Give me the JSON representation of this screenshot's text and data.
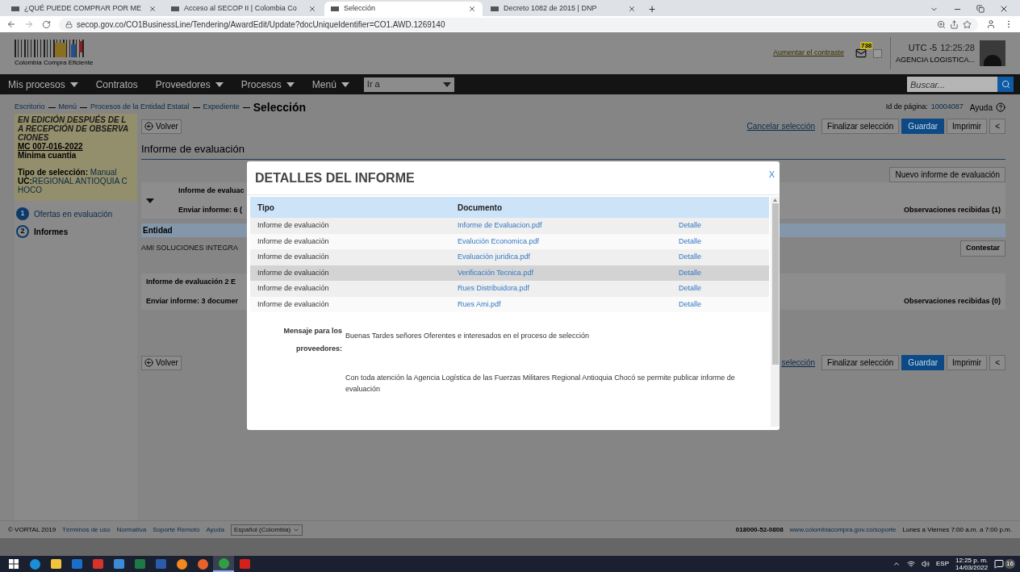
{
  "browser": {
    "tabs": [
      {
        "title": "¿QUÉ PUEDE COMPRAR POR ME",
        "selected": false
      },
      {
        "title": "Acceso al SECOP II | Colombia Co",
        "selected": false
      },
      {
        "title": "Selección",
        "selected": true
      },
      {
        "title": "Decreto 1082 de 2015 | DNP",
        "selected": false
      }
    ],
    "new_tab": "+",
    "url": "secop.gov.co/CO1BusinessLine/Tendering/AwardEdit/Update?docUniqueIdentifier=CO1.AWD.1269140"
  },
  "header": {
    "logo_text": "Colombia Compra Eficiente",
    "contrast_link": "Aumentar el contraste",
    "mail_badge": "738",
    "timezone": "UTC -5",
    "time": "12:25:28",
    "user": "AGENCIA LOGISTICA..."
  },
  "nav": {
    "items": [
      {
        "label": "Mis procesos",
        "dropdown": true
      },
      {
        "label": "Contratos",
        "dropdown": false
      },
      {
        "label": "Proveedores",
        "dropdown": true
      },
      {
        "label": "Procesos",
        "dropdown": true
      },
      {
        "label": "Menú",
        "dropdown": true
      }
    ],
    "goto": "Ir a",
    "search": {
      "placeholder": "Buscar..."
    }
  },
  "breadcrumb": {
    "items": [
      "Escritorio",
      "Menú",
      "Procesos de la Entidad Estatal",
      "Expediente"
    ],
    "current": "Selección"
  },
  "page_id": {
    "label": "Id de página:",
    "value": "10004087"
  },
  "help": "Ayuda",
  "sidebar": {
    "status": "EN EDICIÓN DESPUÉS DE LA RECEPCIÓN DE OBSERVACIONES",
    "process_number": "MC 007-016-2022",
    "modality": "Minima cuantia",
    "selection_type": {
      "label": "Tipo de selección:",
      "value": "Manual"
    },
    "uc": {
      "label": "UC:",
      "value": "REGIONAL ANTIOQUIA CHOCO"
    },
    "steps": [
      {
        "number": "1",
        "label": "Ofertas en evaluación",
        "selected": false
      },
      {
        "number": "2",
        "label": "Informes",
        "selected": true
      }
    ]
  },
  "actions": {
    "back": "Volver",
    "cancel": "Cancelar selección",
    "finish": "Finalizar selección",
    "save": "Guardar",
    "print": "Imprimir",
    "collapse": "<"
  },
  "section_title": "Informe de evaluación",
  "new_report": "Nuevo informe de evaluación",
  "reports": [
    {
      "title": "Informe de evaluac",
      "send": "Enviar informe: 6 (",
      "observations": "Observaciones recibidas (1)",
      "expanded": true
    },
    {
      "title": "Informe de evaluación 2  E",
      "send": "Enviar informe: 3 documer",
      "observations": "Observaciones recibidas (0)",
      "expanded": false
    }
  ],
  "entity_table": {
    "header": "Entidad",
    "entity": "AMI SOLUCIONES INTEGRA",
    "reply": "Contestar"
  },
  "bottom_actions": {
    "back": "Volver",
    "cancel": "selección",
    "finish": "Finalizar selección",
    "save": "Guardar",
    "print": "Imprimir",
    "collapse": "<"
  },
  "modal": {
    "title": "DETALLES DEL INFORME",
    "close": "X",
    "columns": [
      "Tipo",
      "Documento"
    ],
    "rows": [
      {
        "type": "Informe de evaluación",
        "document": "Informe de Evaluacion.pdf",
        "action": "Detalle",
        "selected": false
      },
      {
        "type": "Informe de evaluación",
        "document": "Evalución Economica.pdf",
        "action": "Detalle",
        "selected": false
      },
      {
        "type": "Informe de evaluación",
        "document": "Evaluación juridica.pdf",
        "action": "Detalle",
        "selected": false
      },
      {
        "type": "Informe de evaluación",
        "document": "Verificación Tecnica.pdf",
        "action": "Detalle",
        "selected": true
      },
      {
        "type": "Informe de evaluación",
        "document": "Rues Distribuidora.pdf",
        "action": "Detalle",
        "selected": false
      },
      {
        "type": "Informe de evaluación",
        "document": "Rues Ami.pdf",
        "action": "Detalle",
        "selected": false
      }
    ],
    "message_label": "Mensaje para los proveedores:",
    "message": [
      "Buenas Tardes señores Oferentes e interesados en el proceso de selección",
      "Con toda atención la Agencia Logística de las Fuerzas Militares Regional Antioquia Chocó se permite publicar informe de evaluación"
    ]
  },
  "footer": {
    "copyright": "© VORTAL 2019",
    "links": [
      "Términos de uso",
      "Normativa",
      "Soporte Remoto",
      "Ayuda"
    ],
    "language": "Español (Colombia)",
    "phone": "018000-52-0808",
    "support_url": "www.colombiacompra.gov.co/soporte",
    "hours": "Lunes a Viernes 7:00 a.m. a 7:00 p.m."
  },
  "taskbar": {
    "apps": [
      {
        "kind": "start",
        "selected": false
      },
      {
        "kind": "edge",
        "selected": false
      },
      {
        "kind": "files",
        "selected": false
      },
      {
        "kind": "outlook",
        "selected": false
      },
      {
        "kind": "red",
        "selected": false
      },
      {
        "kind": "tool",
        "selected": false
      },
      {
        "kind": "excel",
        "selected": false
      },
      {
        "kind": "word",
        "selected": false
      },
      {
        "kind": "orange",
        "selected": false
      },
      {
        "kind": "firefox",
        "selected": false
      },
      {
        "kind": "chrome",
        "selected": true
      },
      {
        "kind": "pdf",
        "selected": false
      }
    ],
    "language": "ESP",
    "time": "12:25 p. m.",
    "date": "14/03/2022",
    "notifications": "16"
  }
}
